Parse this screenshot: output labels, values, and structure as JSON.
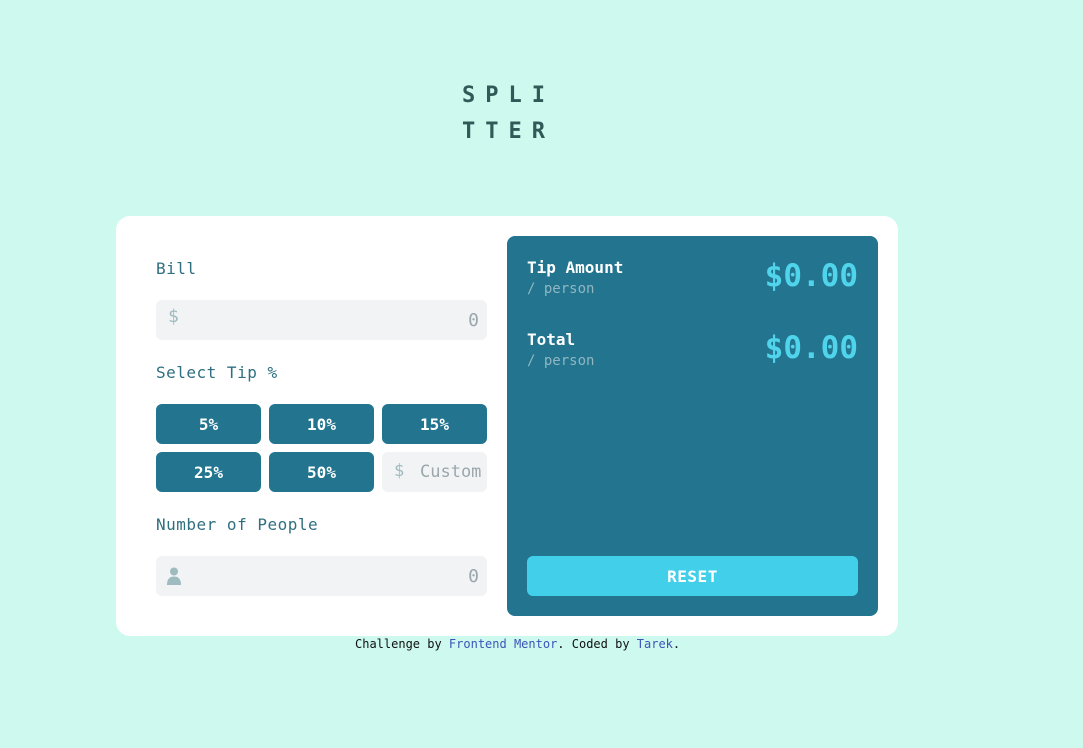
{
  "app": {
    "logo_line1": "SPLI",
    "logo_line2": "TTER"
  },
  "form": {
    "bill_label": "Bill",
    "bill_prefix": "$",
    "bill_placeholder": "0",
    "tip_label": "Select Tip %",
    "tip_options": [
      "5%",
      "10%",
      "15%",
      "25%",
      "50%"
    ],
    "custom_prefix": "$",
    "custom_placeholder": "Custom",
    "people_label": "Number of People",
    "people_placeholder": "0"
  },
  "results": {
    "tip_title": "Tip Amount",
    "tip_sub": "/ person",
    "tip_amount": "$0.00",
    "total_title": "Total",
    "total_sub": "/ person",
    "total_amount": "$0.00",
    "reset_label": "RESET"
  },
  "footer": {
    "prefix": "Challenge by ",
    "fm_link": "Frontend Mentor",
    "middle": ". Coded by ",
    "author_link": "Tarek",
    "suffix": "."
  },
  "colors": {
    "background": "#cdf9ef",
    "primary": "#22748f",
    "accent": "#41cfea",
    "amount": "#4fd4ec"
  },
  "icons": {
    "dollar": "dollar-icon",
    "person": "person-icon"
  }
}
